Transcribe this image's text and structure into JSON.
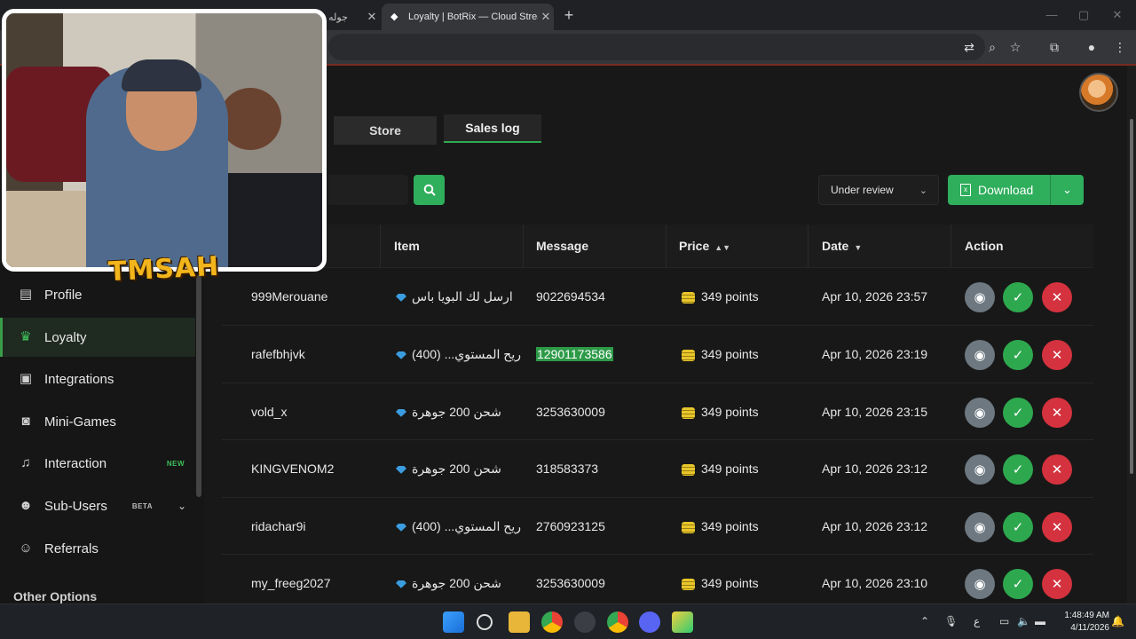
{
  "browser": {
    "tab_inactive_title": "جوله تش",
    "tab_active_title": "Loyalty | BotRix — Cloud Stream",
    "new_tab_label": "+"
  },
  "sidebar": {
    "items": [
      {
        "label": "Profile",
        "icon": "id-card-icon"
      },
      {
        "label": "Loyalty",
        "icon": "trophy-icon",
        "active": true
      },
      {
        "label": "Integrations",
        "icon": "integration-icon"
      },
      {
        "label": "Mini-Games",
        "icon": "gamepad-icon"
      },
      {
        "label": "Interaction",
        "icon": "music-note-icon",
        "badge": "NEW"
      },
      {
        "label": "Sub-Users",
        "icon": "users-icon",
        "badge": "BETA"
      },
      {
        "label": "Referrals",
        "icon": "referrals-icon"
      }
    ],
    "section_title": "Other Options"
  },
  "webcam": {
    "logo_text": "TMSAH"
  },
  "tabs": {
    "store": "Store",
    "sales_log": "Sales log"
  },
  "toolbar": {
    "filter_value": "Under review",
    "download_label": "Download"
  },
  "table": {
    "headers": {
      "item": "Item",
      "message": "Message",
      "price": "Price",
      "date": "Date",
      "action": "Action"
    },
    "rows": [
      {
        "user": "999Merouane",
        "item": "ارسل لك البويا باس",
        "message": "9022694534",
        "price": "349 points",
        "date": "Apr 10, 2026 23:57"
      },
      {
        "user": "rafefbhjvk",
        "item": "(400) ...ريح المستوي",
        "message": "12901173586",
        "price": "349 points",
        "date": "Apr 10, 2026 23:19"
      },
      {
        "user": "vold_x",
        "item": "شحن 200 جوهرة",
        "message": "3253630009",
        "price": "349 points",
        "date": "Apr 10, 2026 23:15"
      },
      {
        "user": "KINGVENOM2",
        "item": "شحن 200 جوهرة",
        "message": "318583373",
        "price": "349 points",
        "date": "Apr 10, 2026 23:12"
      },
      {
        "user": "ridachar9i",
        "item": "(400) ...ريح المستوي",
        "message": "2760923125",
        "price": "349 points",
        "date": "Apr 10, 2026 23:12"
      },
      {
        "user": "my_freeg2027",
        "item": "شحن 200 جوهرة",
        "message": "3253630009",
        "price": "349 points",
        "date": "Apr 10, 2026 23:10"
      }
    ]
  },
  "taskbar": {
    "lang": "ع",
    "time": "1:48:49 AM",
    "date": "4/11/2026"
  },
  "colors": {
    "accent_green": "#2fae5c",
    "danger_red": "#d4323e",
    "view_gray": "#6d7880"
  }
}
